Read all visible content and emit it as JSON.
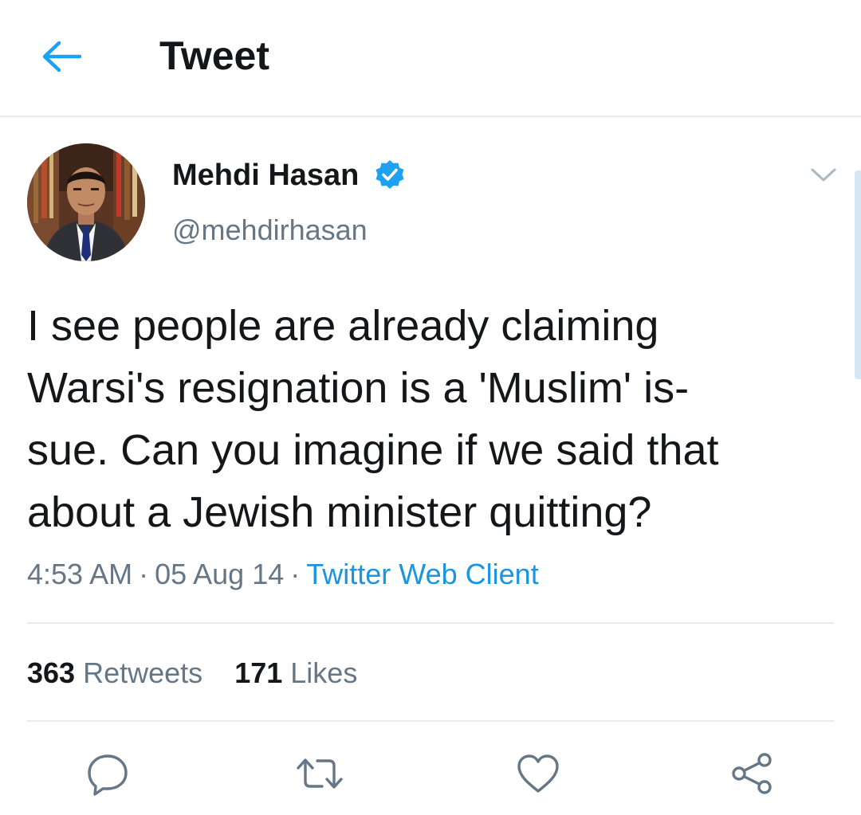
{
  "header": {
    "back_icon": "arrow-left-icon",
    "title": "Tweet"
  },
  "tweet": {
    "author": {
      "name": "Mehdi Hasan",
      "handle": "@mehdirhasan",
      "verified_icon": "verified-badge-icon"
    },
    "text_lines": [
      "I see people are already claiming",
      "Warsi's resignation is a 'Muslim' is-",
      "sue. Can you imagine if we said that",
      "about a Jewish minister quitting?"
    ],
    "time": "4:53 AM",
    "date": "05 Aug 14",
    "separator": "·",
    "client": "Twitter Web Client"
  },
  "stats": {
    "retweets_count": "363",
    "retweets_label": "Retweets",
    "likes_count": "171",
    "likes_label": "Likes"
  },
  "actions": [
    "reply-icon",
    "retweet-icon",
    "like-icon",
    "share-icon"
  ],
  "colors": {
    "accent": "#1da1f2",
    "link": "#1b95e0",
    "text": "#14171a",
    "secondary": "#657786",
    "divider": "#e6ecf0"
  }
}
